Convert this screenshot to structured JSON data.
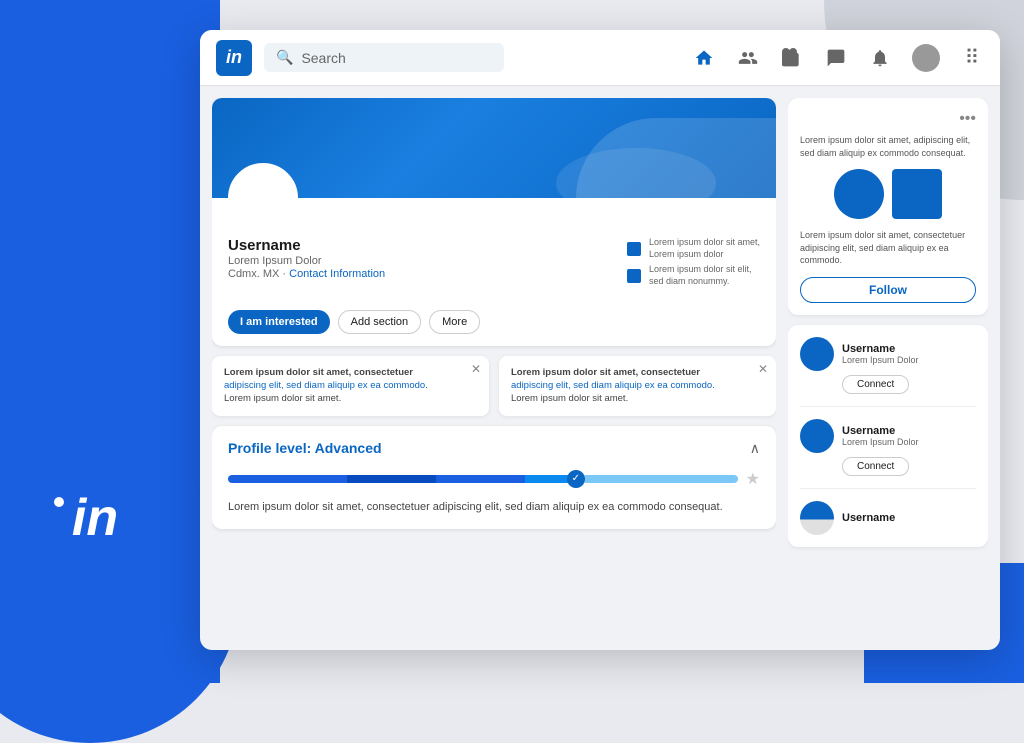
{
  "background": {
    "accent_color": "#1a5fe0"
  },
  "navbar": {
    "logo_text": "in",
    "search_placeholder": "Search",
    "nav_items": [
      {
        "name": "home",
        "icon": "⌂",
        "active": true
      },
      {
        "name": "network",
        "icon": "👥",
        "active": false
      },
      {
        "name": "jobs",
        "icon": "💼",
        "active": false
      },
      {
        "name": "messaging",
        "icon": "💬",
        "active": false
      },
      {
        "name": "notifications",
        "icon": "🔔",
        "active": false
      }
    ],
    "grid_icon": "⠿"
  },
  "profile": {
    "username": "Username",
    "title": "Lorem Ipsum Dolor",
    "location": "Cdmx. MX",
    "contact_link": "Contact Information",
    "stat1_text": "Lorem ipsum dolor sit amet,\nLorem ipsum dolor",
    "stat2_text": "Lorem ipsum dolor sit elit,\nsed diam nonummy.",
    "btn_interested": "I am interested",
    "btn_add_section": "Add section",
    "btn_more": "More"
  },
  "activity_cards": [
    {
      "title": "Lorem ipsum dolor sit amet, consectetuer",
      "body": "adipiscing elit, sed diam aliquip ex ea commodo.",
      "footer": "Lorem ipsum dolor sit amet."
    },
    {
      "title": "Lorem ipsum dolor sit amet, consectetuer",
      "body": "adipiscing elit, sed diam aliquip ex ea commodo.",
      "footer": "Lorem ipsum dolor sit amet."
    }
  ],
  "profile_level": {
    "title": "Profile level:",
    "level": "Advanced",
    "description": "Lorem ipsum dolor sit amet, consectetuer adipiscing elit,\nsed diam aliquip ex ea commodo consequat.",
    "progress": 70
  },
  "ad_card": {
    "menu_dots": "•••",
    "text": "Lorem ipsum dolor sit amet, adipiscing elit, sed\ndiam aliquip ex commodo consequat.",
    "description": "Lorem ipsum dolor sit amet, consectetuer\nadipiscing elit, sed diam aliquip ex ea commodo.",
    "follow_btn": "Follow"
  },
  "people": {
    "items": [
      {
        "name": "Username",
        "title": "Lorem Ipsum Dolor",
        "btn": "Connect"
      },
      {
        "name": "Username",
        "title": "Lorem Ipsum Dolor",
        "btn": "Connect"
      },
      {
        "name": "Username",
        "title": "",
        "btn": ""
      }
    ]
  }
}
